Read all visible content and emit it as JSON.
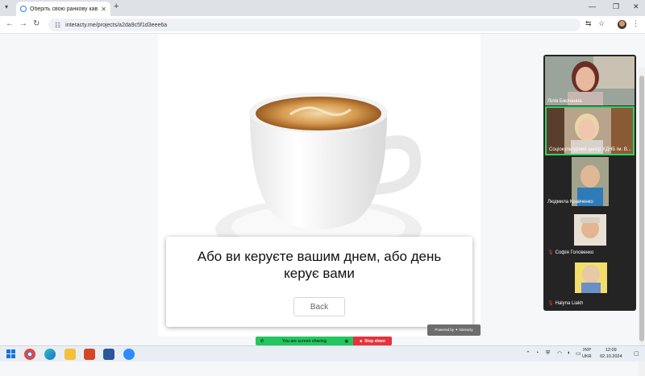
{
  "browser": {
    "tab_title": "Оберіть свою ранкову каву! |",
    "new_tab": "+",
    "url": "interacty.me/projects/a2da9c5f1d3eee6a",
    "window_controls": [
      "—",
      "❐",
      "✕"
    ]
  },
  "quiz": {
    "question": "Або ви керуєте вашим днем, або день керує вами",
    "back_label": "Back",
    "powered_by": "Powered by ✦ Interacty"
  },
  "participants": [
    {
      "name": "Лілія Бжочанна",
      "muted": false
    },
    {
      "name": "Соціокультурний центр ХДНБ ім. В...",
      "muted": false
    },
    {
      "name": "Людмила Кравченко",
      "muted": false
    },
    {
      "name": "Софія Головенко",
      "muted": true
    },
    {
      "name": "Halyna Liakh",
      "muted": true
    }
  ],
  "screen_share": {
    "status": "You are screen sharing",
    "stop_label": "Stop share"
  },
  "taskbar": {
    "language": "УКР",
    "language2": "UKR",
    "time": "12:09",
    "date": "02.10.2024"
  },
  "colors": {
    "active_speaker_border": "#2fd366",
    "share_green": "#23c55e",
    "stop_red": "#e5323b"
  }
}
